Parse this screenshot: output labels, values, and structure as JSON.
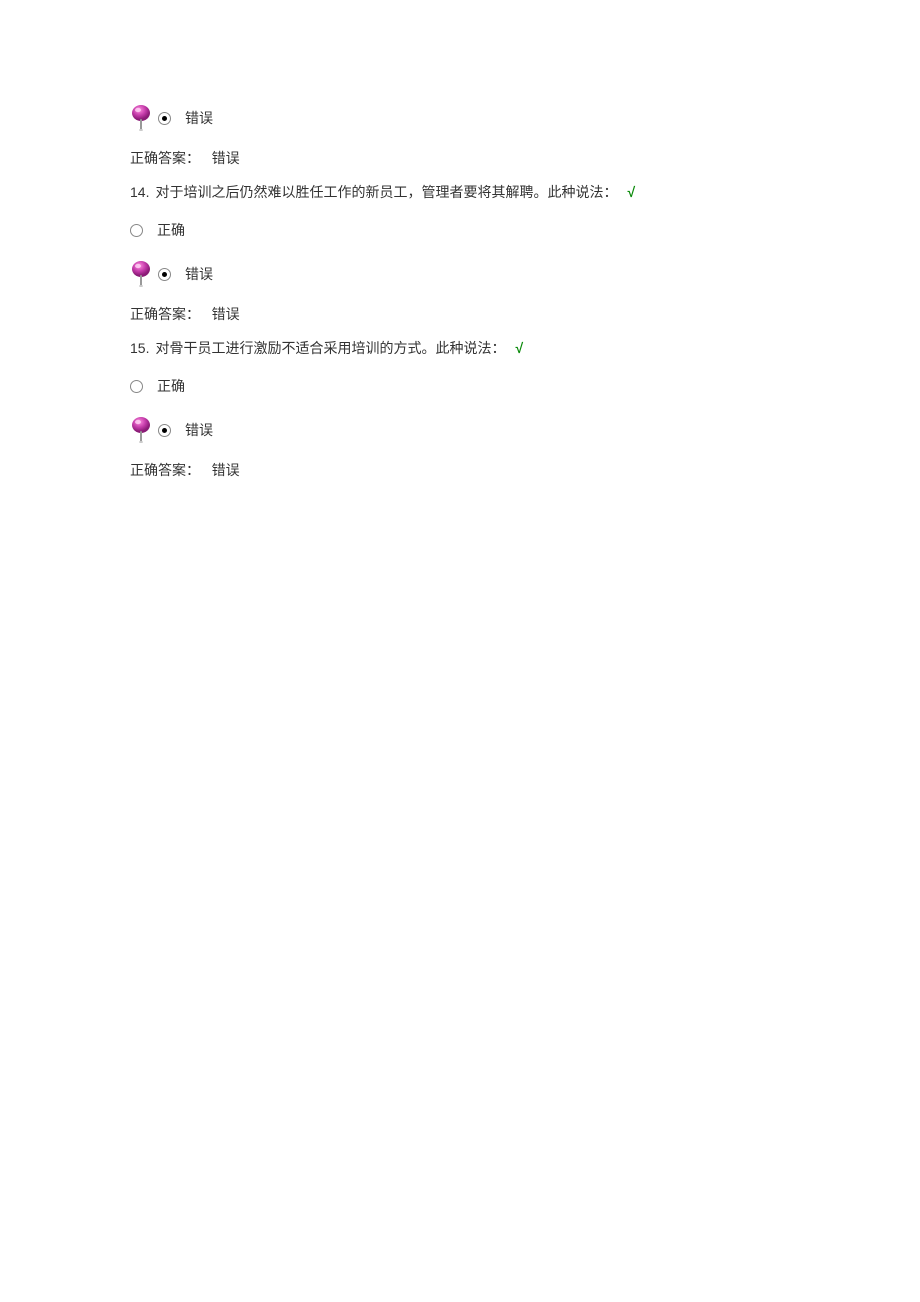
{
  "q13": {
    "option_false_label": "错误",
    "answer_prefix": "正确答案：",
    "answer_value": "错误"
  },
  "q14": {
    "number": "14.",
    "text": "对于培训之后仍然难以胜任工作的新员工，管理者要将其解聘。此种说法：",
    "check": "√",
    "option_true_label": "正确",
    "option_false_label": "错误",
    "answer_prefix": "正确答案：",
    "answer_value": "错误"
  },
  "q15": {
    "number": "15.",
    "text": "对骨干员工进行激励不适合采用培训的方式。此种说法：",
    "check": "√",
    "option_true_label": "正确",
    "option_false_label": "错误",
    "answer_prefix": "正确答案：",
    "answer_value": "错误"
  }
}
